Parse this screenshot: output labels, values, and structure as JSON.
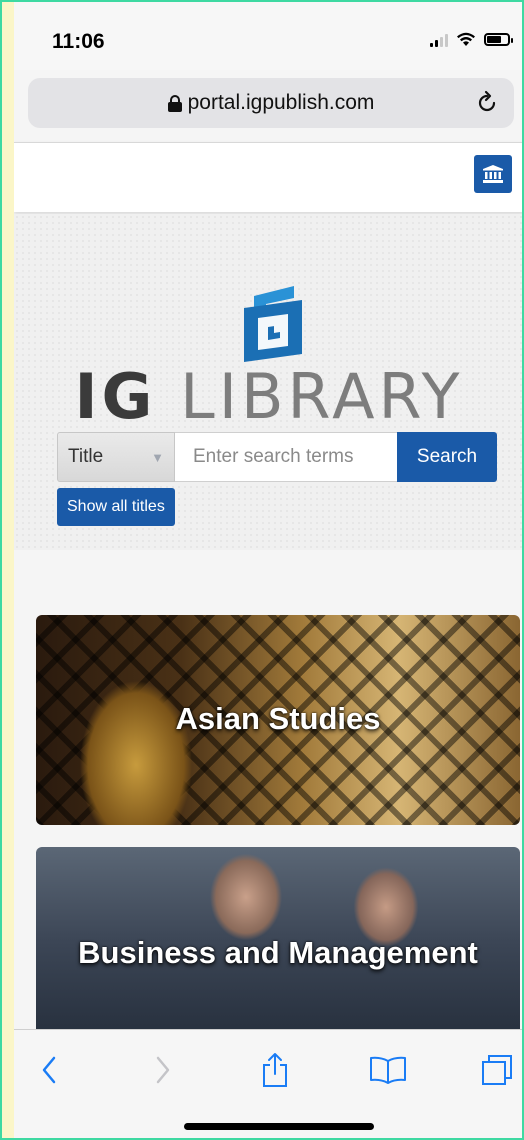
{
  "status_bar": {
    "time": "11:06",
    "icons": [
      "cellular-signal-icon",
      "wifi-icon",
      "battery-icon"
    ]
  },
  "browser": {
    "url": "portal.igpublish.com",
    "icons": [
      "lock-icon",
      "reload-icon"
    ]
  },
  "header": {
    "institution_icon": "institution-building-icon",
    "accent_color": "#1a5aa8"
  },
  "hero": {
    "logo_ig": "IG",
    "logo_library": "LIBRARY",
    "search": {
      "field_select_value": "Title",
      "input_placeholder": "Enter search terms",
      "button_label": "Search"
    },
    "show_all_label": "Show all titles"
  },
  "categories": [
    {
      "label": "Asian Studies"
    },
    {
      "label": "Business and Management"
    }
  ],
  "toolbar": {
    "buttons": [
      "back-icon",
      "forward-icon",
      "share-icon",
      "bookmarks-icon",
      "tabs-icon"
    ]
  }
}
